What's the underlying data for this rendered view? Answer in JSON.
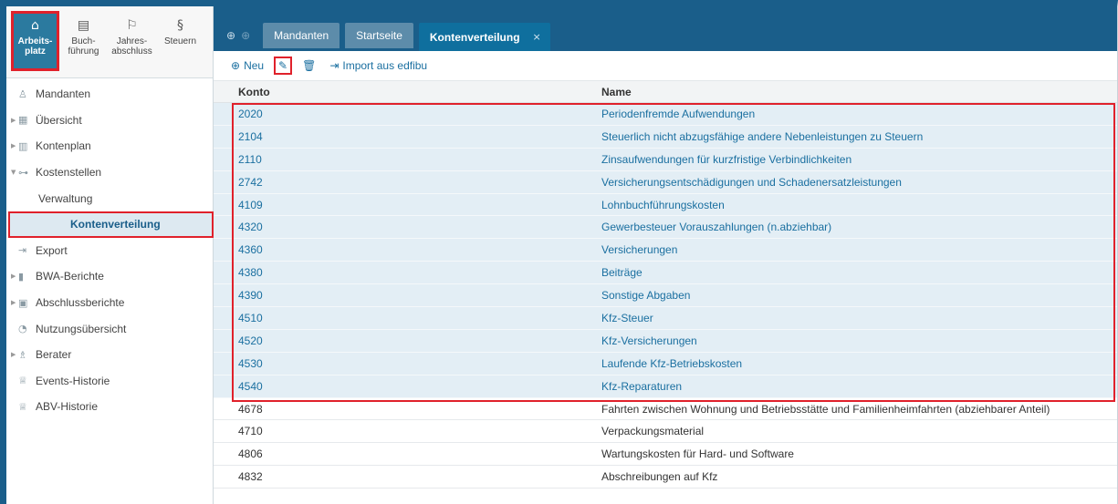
{
  "topnav": [
    {
      "label": "Arbeits-\nplatz",
      "icon": "home-icon",
      "glyph": "⌂"
    },
    {
      "label": "Buch-\nführung",
      "icon": "book-icon",
      "glyph": "▤"
    },
    {
      "label": "Jahres-\nabschluss",
      "icon": "flag-icon",
      "glyph": "⚐"
    },
    {
      "label": "Steuern",
      "icon": "paragraph-icon",
      "glyph": "§"
    }
  ],
  "tree": [
    {
      "label": "Mandanten",
      "icon": "user-icon",
      "glyph": "♙",
      "arrow": ""
    },
    {
      "label": "Übersicht",
      "icon": "grid-icon",
      "glyph": "▦",
      "arrow": "▶"
    },
    {
      "label": "Kontenplan",
      "icon": "table-icon",
      "glyph": "▥",
      "arrow": "▶"
    },
    {
      "label": "Kostenstellen",
      "icon": "hierarchy-icon",
      "glyph": "⊶",
      "arrow": "▼"
    }
  ],
  "tree_sub": [
    "Verwaltung",
    "Kontenverteilung"
  ],
  "tree2": [
    {
      "label": "Export",
      "icon": "export-icon",
      "glyph": "⇥",
      "arrow": ""
    },
    {
      "label": "BWA-Berichte",
      "icon": "bar-chart-icon",
      "glyph": "▮",
      "arrow": "▶"
    },
    {
      "label": "Abschlussberichte",
      "icon": "report-icon",
      "glyph": "▣",
      "arrow": "▶"
    },
    {
      "label": "Nutzungsübersicht",
      "icon": "pie-chart-icon",
      "glyph": "◔",
      "arrow": ""
    },
    {
      "label": "Berater",
      "icon": "people-icon",
      "glyph": "♗",
      "arrow": "▶"
    },
    {
      "label": "Events-Historie",
      "icon": "crown-icon",
      "glyph": "♕",
      "arrow": ""
    },
    {
      "label": "ABV-Historie",
      "icon": "crown-icon",
      "glyph": "♕",
      "arrow": ""
    }
  ],
  "tabs": [
    "Mandanten",
    "Startseite",
    "Kontenverteilung"
  ],
  "tab_close": "×",
  "history": {
    "back": "⊕",
    "forward": "⊕"
  },
  "toolbar": {
    "new_label": "Neu",
    "new_glyph": "⊕",
    "edit_glyph": "✎",
    "delete_glyph": "🗑",
    "import_label": "Import aus edfibu",
    "import_glyph": "⇥"
  },
  "table": {
    "headers": [
      "Konto",
      "Name"
    ],
    "rows": [
      [
        "2020",
        "Periodenfremde Aufwendungen"
      ],
      [
        "2104",
        "Steuerlich nicht abzugsfähige andere Nebenleistungen zu Steuern"
      ],
      [
        "2110",
        "Zinsaufwendungen für kurzfristige Verbindlichkeiten"
      ],
      [
        "2742",
        "Versicherungsentschädigungen und Schadenersatzleistungen"
      ],
      [
        "4109",
        "Lohnbuchführungskosten"
      ],
      [
        "4320",
        "Gewerbesteuer Vorauszahlungen (n.abziehbar)"
      ],
      [
        "4360",
        "Versicherungen"
      ],
      [
        "4380",
        "Beiträge"
      ],
      [
        "4390",
        "Sonstige Abgaben"
      ],
      [
        "4510",
        "Kfz-Steuer"
      ],
      [
        "4520",
        "Kfz-Versicherungen"
      ],
      [
        "4530",
        "Laufende Kfz-Betriebskosten"
      ],
      [
        "4540",
        "Kfz-Reparaturen"
      ],
      [
        "4678",
        "Fahrten zwischen Wohnung und Betriebsstätte und Familienheimfahrten (abziehbarer Anteil)"
      ],
      [
        "4710",
        "Verpackungsmaterial"
      ],
      [
        "4806",
        "Wartungskosten für Hard- und Software"
      ],
      [
        "4832",
        "Abschreibungen auf Kfz"
      ]
    ],
    "highlighted_count": 13
  },
  "colors": {
    "brand": "#1a5e8a",
    "accent": "#2b7a9f",
    "highlight": "#e3eef5",
    "annotation": "#e0212b"
  }
}
